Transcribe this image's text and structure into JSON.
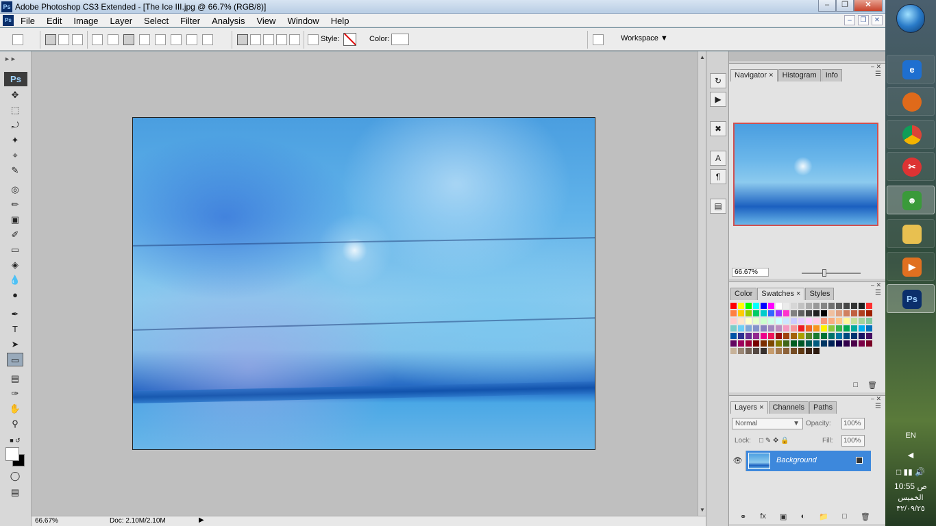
{
  "window": {
    "title": "Adobe Photoshop CS3 Extended - [The Ice III.jpg @ 66.7% (RGB/8)]"
  },
  "menu": [
    "File",
    "Edit",
    "Image",
    "Layer",
    "Select",
    "Filter",
    "Analysis",
    "View",
    "Window",
    "Help"
  ],
  "options": {
    "style_label": "Style:",
    "color_label": "Color:",
    "workspace_label": "Workspace"
  },
  "status": {
    "zoom": "66.67%",
    "doc_size": "Doc: 2.10M/2.10M"
  },
  "navigator_panel": {
    "tabs": [
      "Navigator",
      "Histogram",
      "Info"
    ],
    "zoom": "66.67%"
  },
  "swatches_panel": {
    "tabs": [
      "Color",
      "Swatches",
      "Styles"
    ]
  },
  "layers_panel": {
    "tabs": [
      "Layers",
      "Channels",
      "Paths"
    ],
    "blend_mode": "Normal",
    "opacity_label": "Opacity:",
    "opacity": "100%",
    "lock_label": "Lock:",
    "fill_label": "Fill:",
    "fill": "100%",
    "layers": [
      {
        "name": "Background",
        "visible": true,
        "locked": true
      }
    ]
  },
  "taskbar": {
    "apps": [
      "internet-explorer",
      "firefox",
      "chrome",
      "snipping-tool",
      "messenger",
      "folder",
      "media-player",
      "photoshop"
    ],
    "language": "EN",
    "time": "10:55 ص",
    "day": "الخميس",
    "date": "٣٢/٠٩/٢٥"
  },
  "colors": {
    "accent": "#3d88dc",
    "canvas_bg": "#bfbfbf",
    "panel_bg": "#e3e3e3"
  },
  "swatch_colors": [
    "#ff0000",
    "#ffff00",
    "#00ff00",
    "#00ffff",
    "#0000ff",
    "#ff00ff",
    "#ffffff",
    "#ebebeb",
    "#d6d6d6",
    "#c2c2c2",
    "#adadad",
    "#999999",
    "#858585",
    "#707070",
    "#5c5c5c",
    "#474747",
    "#333333",
    "#1f1f1f",
    "#ff3030",
    "#ff8040",
    "#ffcc00",
    "#99cc00",
    "#00cc66",
    "#00cccc",
    "#3366ff",
    "#9933ff",
    "#ff33cc",
    "#808080",
    "#606060",
    "#404040",
    "#202020",
    "#000000",
    "#f0c0a0",
    "#e0a080",
    "#d08060",
    "#c06040",
    "#b04020",
    "#a02000",
    "#ffcccc",
    "#ffe6cc",
    "#ffffcc",
    "#e6ffcc",
    "#ccffcc",
    "#ccffe6",
    "#ccffff",
    "#cce6ff",
    "#ccccff",
    "#e6ccff",
    "#ffccff",
    "#ffcce6",
    "#f7977a",
    "#f9ad81",
    "#fdc68a",
    "#fff79a",
    "#c4df9b",
    "#a2d39c",
    "#82ca9d",
    "#7bcdc8",
    "#6ecff6",
    "#7ea7d8",
    "#8493ca",
    "#8882be",
    "#a187be",
    "#bc8dbf",
    "#f49ac2",
    "#f6989d",
    "#ed1c24",
    "#f26522",
    "#f7941d",
    "#fff200",
    "#8dc73f",
    "#39b54a",
    "#00a651",
    "#00a99d",
    "#00aeef",
    "#0072bc",
    "#0054a6",
    "#2e3192",
    "#662d91",
    "#92278f",
    "#ec008c",
    "#ed145b",
    "#9e0b0f",
    "#a0410d",
    "#a36209",
    "#aba000",
    "#598527",
    "#1a7b30",
    "#007236",
    "#00746b",
    "#0076a3",
    "#004b80",
    "#003471",
    "#1b1464",
    "#440e62",
    "#630460",
    "#9e005d",
    "#9e0039",
    "#790000",
    "#7b2e00",
    "#7d4900",
    "#827b00",
    "#406618",
    "#005e20",
    "#005826",
    "#005952",
    "#005b7f",
    "#003663",
    "#002157",
    "#0d004c",
    "#32004b",
    "#4b0049",
    "#7b0046",
    "#7a0026",
    "#c7b299",
    "#998675",
    "#736357",
    "#534741",
    "#37302d",
    "#c69c6d",
    "#a67c52",
    "#8c6239",
    "#754c24",
    "#603913",
    "#3c2415",
    "#2b1a10"
  ]
}
